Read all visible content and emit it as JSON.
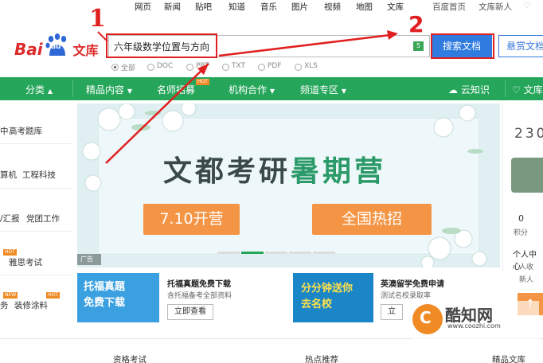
{
  "top_nav": {
    "links": [
      "网页",
      "新闻",
      "贴吧",
      "知道",
      "音乐",
      "图片",
      "视频",
      "地图",
      "文库"
    ],
    "right_links": [
      "百度首页",
      "文库新人"
    ]
  },
  "logo": {
    "bai": "Bai",
    "du": "du",
    "wenku": "文库"
  },
  "search": {
    "query": "六年级数学位置与方向",
    "flag": "5",
    "button": "搜索文档",
    "reward_button": "悬赏文档"
  },
  "filters": [
    "全部",
    "DOC",
    "PPT",
    "TXT",
    "PDF",
    "XLS"
  ],
  "nav": {
    "tabs": [
      "分类",
      "精品内容",
      "名师招募",
      "机构合作",
      "频道专区"
    ],
    "right": [
      "云知识",
      "文库"
    ],
    "hot_badge": "HOT"
  },
  "sidebar": {
    "items": [
      "中",
      "高考题库",
      "算机",
      "工程科技",
      "/汇报",
      "党团工作",
      "雅思考试",
      "务",
      "装修涂料"
    ],
    "badges": [
      "HOT",
      "HOT",
      "NEW"
    ]
  },
  "banner": {
    "title_part1": "文都考研",
    "title_part2": "暑期营",
    "button1": "7.10开营",
    "button2": "全国热招",
    "ad_tag": "广告"
  },
  "cards": [
    {
      "image_text": "托福真题免费下载",
      "title": "托福真题免费下载",
      "subtitle": "含托福备考全部资料",
      "button": "立即查看"
    },
    {
      "image_text": "分分钟送你去名校",
      "title": "英澳留学免费申请",
      "subtitle": "测试名校录取率",
      "button": "立"
    }
  ],
  "right_panel": {
    "digits": "230",
    "points_value": "0",
    "points_label": "积分",
    "personal_center": "个人中心",
    "items": [
      "人收",
      "新人"
    ]
  },
  "bottom_tabs": [
    "资格考试",
    "热点推荐",
    "精品文库"
  ],
  "annotations": {
    "one": "1",
    "two": "2"
  },
  "watermark": {
    "name": "酷知网",
    "url": "www.coozhi.com"
  },
  "colors": {
    "green": "#26a65b",
    "blue": "#2f7be0",
    "red": "#e02020",
    "orange": "#f49545"
  }
}
